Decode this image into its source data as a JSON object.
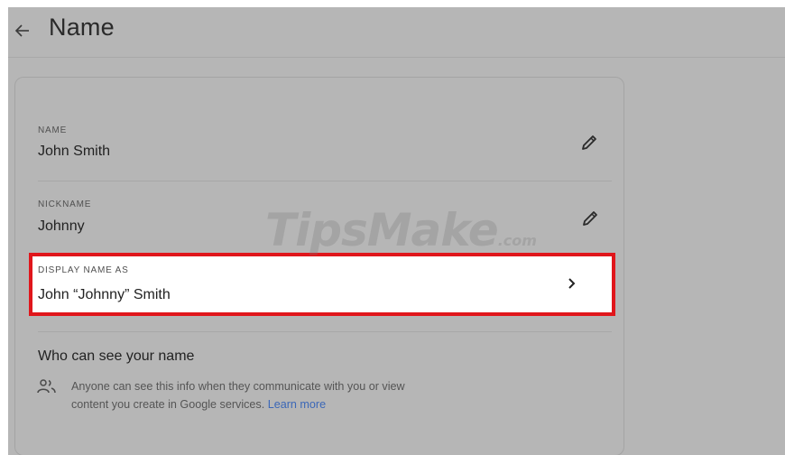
{
  "header": {
    "back_icon": "arrow-left-icon",
    "title": "Name"
  },
  "fields": {
    "name": {
      "label": "NAME",
      "value": "John Smith",
      "edit_icon": "pencil-icon"
    },
    "nickname": {
      "label": "NICKNAME",
      "value": "Johnny",
      "edit_icon": "pencil-icon"
    },
    "display_name": {
      "label": "DISPLAY NAME AS",
      "value": "John “Johnny” Smith",
      "icon": "chevron-right-icon",
      "highlight_color": "#e0161b"
    }
  },
  "visibility": {
    "title": "Who can see your name",
    "icon": "people-icon",
    "text": "Anyone can see this info when they communicate with you or view content you create in Google services.",
    "link": "Learn more"
  },
  "watermark": {
    "text": "TipsMake",
    "suffix": ".com"
  }
}
